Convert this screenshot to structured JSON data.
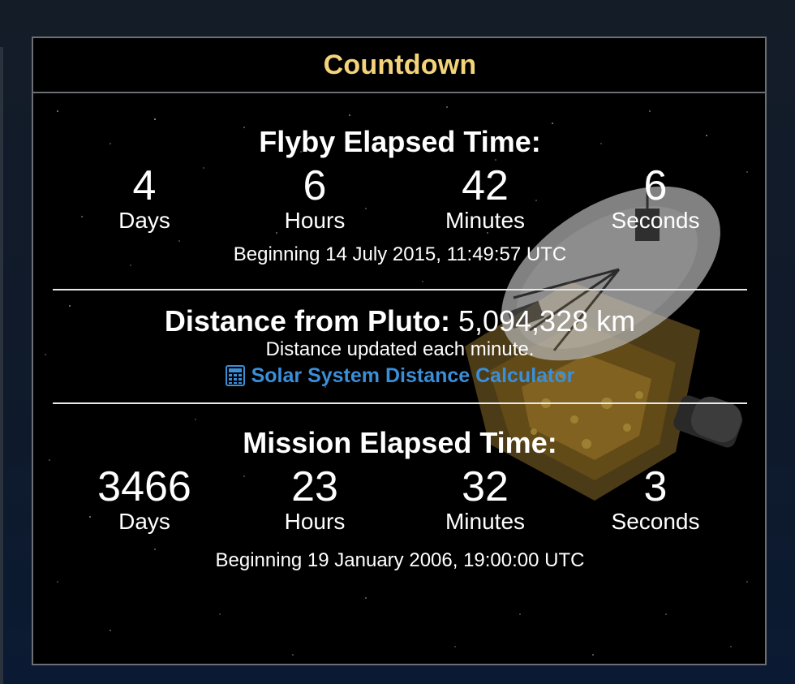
{
  "widget": {
    "title": "Countdown"
  },
  "flyby": {
    "heading": "Flyby Elapsed Time:",
    "counters": [
      {
        "value": "4",
        "label": "Days"
      },
      {
        "value": "6",
        "label": "Hours"
      },
      {
        "value": "42",
        "label": "Minutes"
      },
      {
        "value": "6",
        "label": "Seconds"
      }
    ],
    "beginning": "Beginning 14 July 2015, 11:49:57 UTC"
  },
  "distance": {
    "label": "Distance from Pluto:",
    "value": "5,094,328 km",
    "note": "Distance updated each minute.",
    "link_label": "Solar System Distance Calculator",
    "link_icon": "calculator-icon",
    "link_color": "#3b8ed8"
  },
  "mission": {
    "heading": "Mission Elapsed Time:",
    "counters": [
      {
        "value": "3466",
        "label": "Days"
      },
      {
        "value": "23",
        "label": "Hours"
      },
      {
        "value": "32",
        "label": "Minutes"
      },
      {
        "value": "3",
        "label": "Seconds"
      }
    ],
    "beginning": "Beginning 19 January 2006, 19:00:00 UTC"
  },
  "colors": {
    "title": "#f3d47a",
    "panel_background": "#000000",
    "panel_border": "#6c6f74",
    "page_background": "#0f1a2a"
  }
}
